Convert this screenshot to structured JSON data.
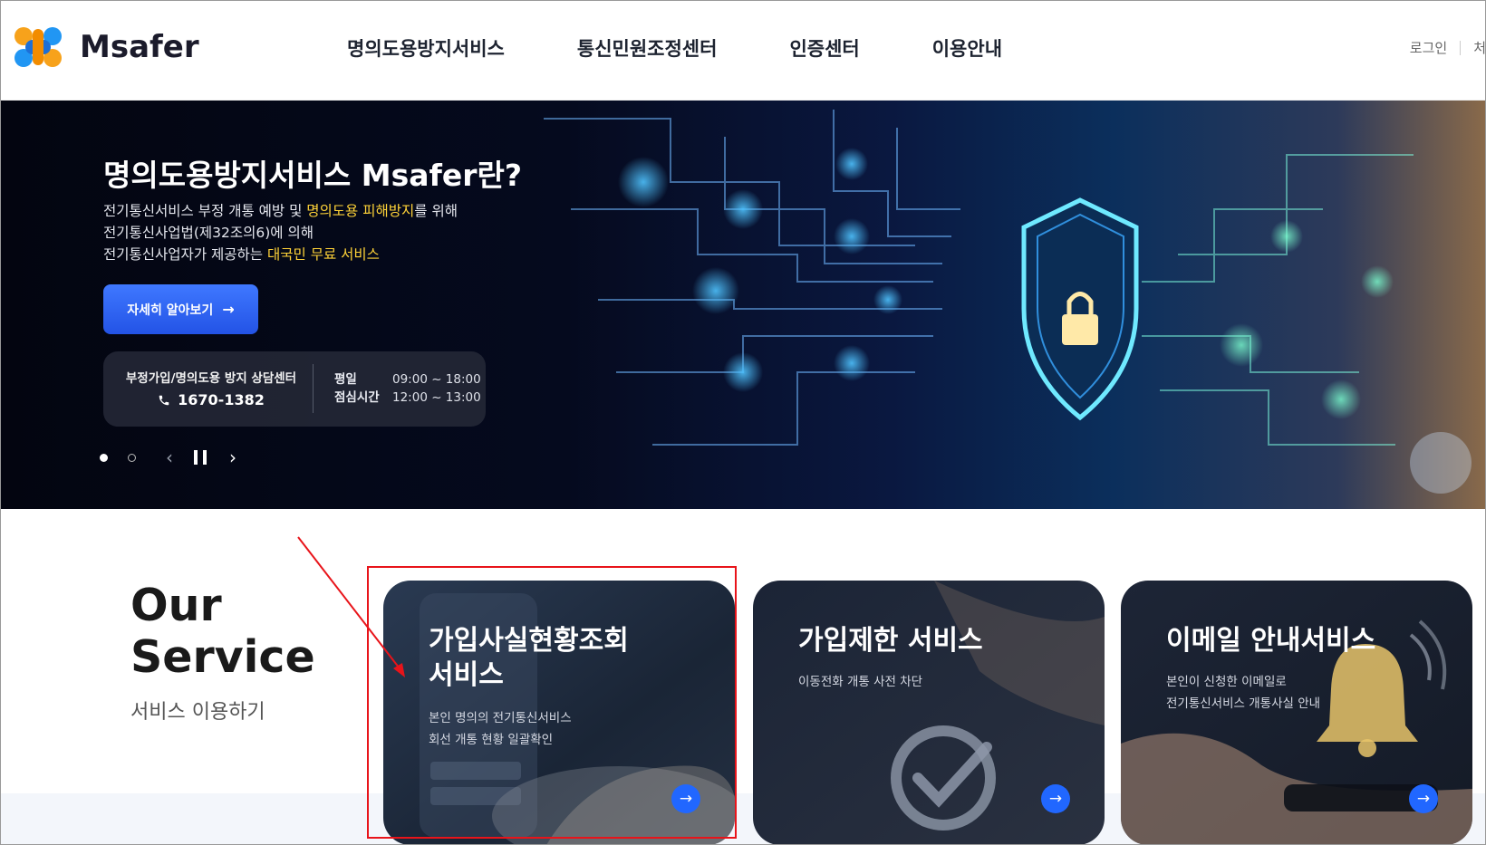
{
  "header": {
    "logo_text": "Msafer",
    "nav": [
      "명의도용방지서비스",
      "통신민원조정센터",
      "인증센터",
      "이용안내"
    ],
    "login": "로그인",
    "util_cut": "처"
  },
  "hero": {
    "title": "명의도용방지서비스 Msafer란?",
    "line1_a": "전기통신서비스 부정 개통 예방 및 ",
    "line1_hl": "명의도용 피해방지",
    "line1_b": "를 위해",
    "line2": "전기통신사업법(제32조의6)에 의해",
    "line3_a": "전기통신사업자가 제공하는 ",
    "line3_hl": "대국민 무료 서비스",
    "button": "자세히 알아보기",
    "button_arrow": "→",
    "consult_title": "부정가입/명의도용 방지 상담센터",
    "phone": "1670-1382",
    "hours": [
      {
        "label": "평일",
        "value": "09:00 ~ 18:00"
      },
      {
        "label": "점심시간",
        "value": "12:00 ~ 13:00"
      }
    ],
    "slider": {
      "prev": "‹",
      "next": "›"
    }
  },
  "our_service": {
    "title_line1": "Our",
    "title_line2": "Service",
    "subtitle": "서비스 이용하기",
    "cards": [
      {
        "title_line1": "가입사실현황조회",
        "title_line2": "서비스",
        "desc_line1": "본인 명의의 전기통신서비스",
        "desc_line2": "회선 개통 현황 일괄확인",
        "arrow": "→"
      },
      {
        "title_line1": "가입제한 서비스",
        "title_line2": "",
        "desc_line1": "이동전화 개통 사전 차단",
        "desc_line2": "",
        "arrow": "→"
      },
      {
        "title_line1": "이메일 안내서비스",
        "title_line2": "",
        "desc_line1": "본인이 신청한 이메일로",
        "desc_line2": "전기통신서비스 개통사실 안내",
        "arrow": "→"
      }
    ]
  },
  "colors": {
    "accent": "#2167ff",
    "highlight": "#ffd338",
    "annotation": "#e8141a"
  }
}
